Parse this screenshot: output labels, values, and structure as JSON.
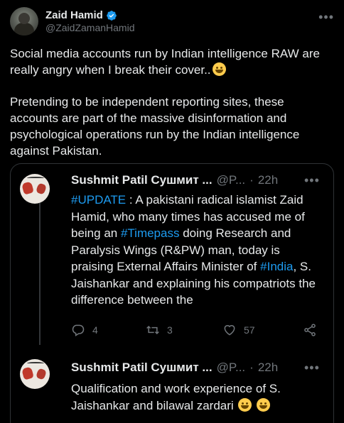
{
  "tweet": {
    "author_name": "Zaid Hamid",
    "author_handle": "@ZaidZamanHamid",
    "paragraph1": "Social media accounts run by Indian intelligence RAW are really angry when I break their cover..",
    "paragraph2": "Pretending to be independent reporting sites, these accounts are part of the massive disinformation and psychological operations run by the Indian intelligence against Pakistan.",
    "icons": [
      "verified-badge-icon",
      "more-options-icon",
      "grinning-emoji-icon"
    ]
  },
  "thread": {
    "reply1": {
      "author_name": "Sushmit Patil Сушмит ...",
      "author_handle": "@P...",
      "dot": "·",
      "time": "22h",
      "text": {
        "hashtag_update": "#UPDATE",
        "part1": " : A pakistani radical islamist Zaid Hamid, who many times has accused me of being an ",
        "hashtag_timepass": "#Timepass",
        "part2": " doing Research and Paralysis Wings (R&PW) man, today is praising External Affairs Minister of ",
        "hashtag_india": "#India",
        "part3": ", S. Jaishankar and explaining his compatriots the difference between the"
      },
      "replies_count": "4",
      "retweets_count": "3",
      "likes_count": "57"
    },
    "reply2": {
      "author_name": "Sushmit Patil Сушмит ...",
      "author_handle": "@P...",
      "dot": "·",
      "time": "22h",
      "text": "Qualification and work experience of S. Jaishankar and bilawal zardari"
    },
    "accent_color": "#1d9bf0"
  }
}
